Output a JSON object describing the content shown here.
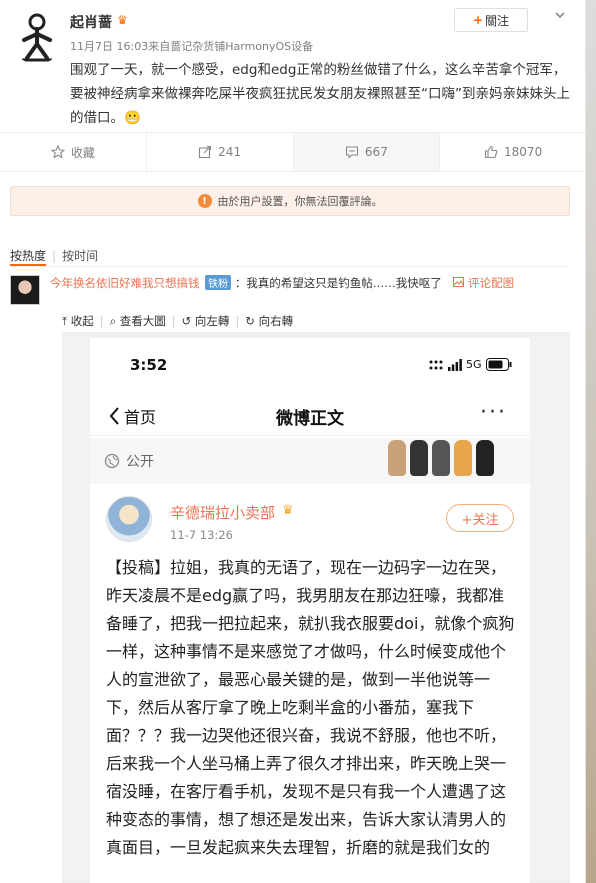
{
  "header": {
    "username": "起肖蔷",
    "post_meta": "11月7日 16:03来自蔷记杂货铺HarmonyOS设备",
    "follow_label": "關注",
    "post_text": "围观了一天，就一个感受，edg和edg正常的粉丝做错了什么，这么辛苦拿个冠军，要被神经病拿来做裸奔吃屎半夜疯狂扰民发女朋友裸照甚至“口嗨”到亲妈亲妹妹头上的借口。😬"
  },
  "actions": [
    {
      "label": "收藏",
      "icon": "star-icon"
    },
    {
      "label": "241",
      "icon": "share-icon"
    },
    {
      "label": "667",
      "icon": "comment-icon"
    },
    {
      "label": "18070",
      "icon": "like-icon"
    }
  ],
  "notice": {
    "text": "由於用户設置，你無法回覆評論。"
  },
  "sort": {
    "hot": "按热度",
    "time": "按时间"
  },
  "comment": {
    "user": "今年换名依旧好难我只想搞钱",
    "fan_badge": "铁粉",
    "body": "：我真的希望这只是钓鱼帖……我快呕了",
    "pic_link": "评论配图"
  },
  "image_toolbar": {
    "collapse": "收起",
    "view_large": "查看大圖",
    "rotate_left": "向左轉",
    "rotate_right": "向右轉"
  },
  "phone": {
    "time": "3:52",
    "network": "5G",
    "back_label": "首页",
    "nav_title": "微博正文",
    "public_label": "公开",
    "author": "辛德瑞拉小卖部",
    "date": "11-7 13:26",
    "follow_label": "+关注",
    "body": "【投稿】拉姐，我真的无语了，现在一边码字一边在哭，昨天凌晨不是edg赢了吗，我男朋友在那边狂嚎，我都准备睡了，把我一把拉起来，就扒我衣服要doi，就像个疯狗一样，这种事情不是来感觉了才做吗，什么时候变成他个人的宣泄欲了，最恶心最关键的是，做到一半他说等一下，然后从客厅拿了晚上吃剩半盒的小番茄，塞我下面？？？我一边哭他还很兴奋，我说不舒服，他也不听，后来我一个人坐马桶上弄了很久才排出来，昨天晚上哭一宿没睡，在客厅看手机，发现不是只有我一个人遭遇了这种变态的事情，想了想还是发出来，告诉大家认清男人的真面目，一旦发起疯来失去理智，折磨的就是我们女的"
  },
  "colors": {
    "accent": "#eb7350",
    "orange": "#ff6600",
    "notice_bg": "#fdf0e8"
  }
}
